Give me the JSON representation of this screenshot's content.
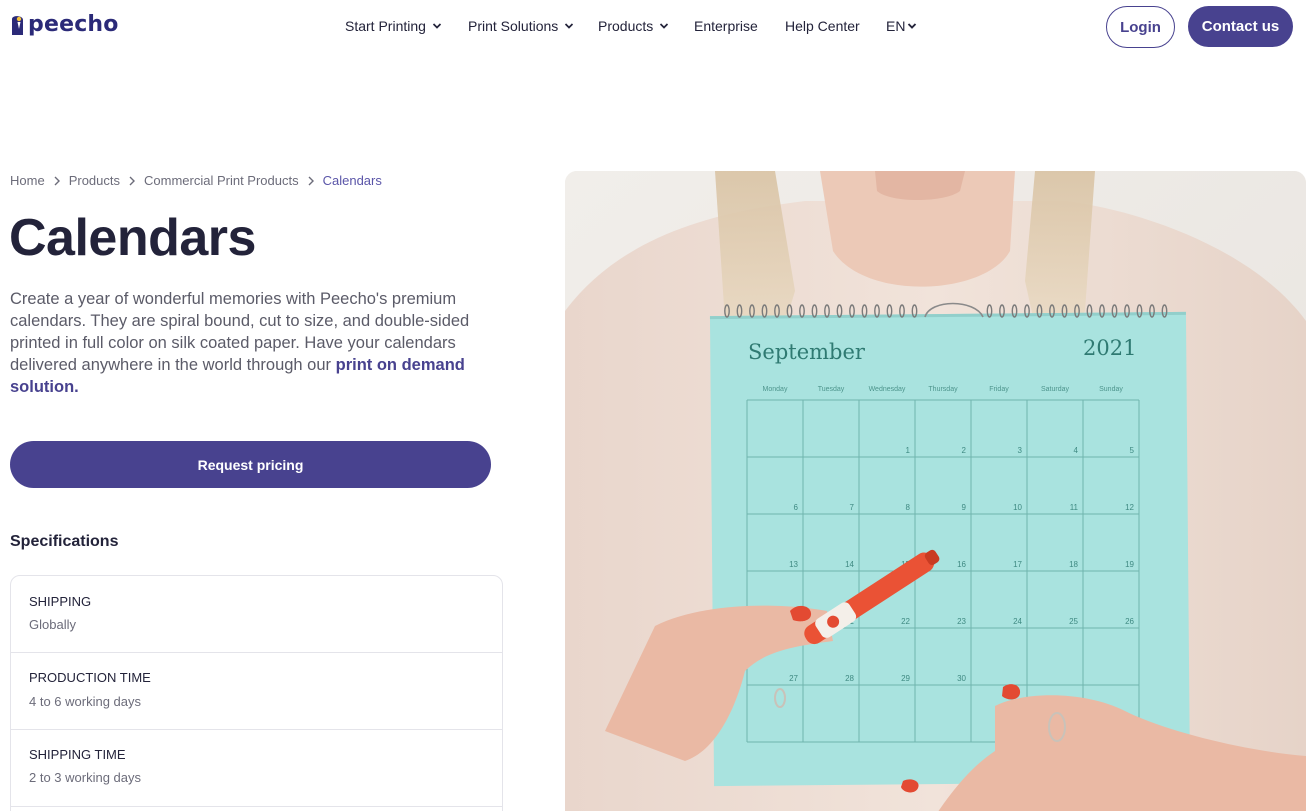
{
  "brand": {
    "name": "peecho",
    "color": "#2b2a78",
    "accent": "#48428f"
  },
  "nav": {
    "items": [
      {
        "label": "Start Printing",
        "dropdown": true
      },
      {
        "label": "Print Solutions",
        "dropdown": true
      },
      {
        "label": "Products",
        "dropdown": true
      },
      {
        "label": "Enterprise",
        "dropdown": false
      },
      {
        "label": "Help Center",
        "dropdown": false
      },
      {
        "label": "EN",
        "dropdown": true
      }
    ],
    "login_label": "Login",
    "contact_label": "Contact us"
  },
  "breadcrumb": [
    "Home",
    "Products",
    "Commercial Print Products",
    "Calendars"
  ],
  "page": {
    "title": "Calendars",
    "description_text": "Create a year of wonderful memories with Peecho's premium calendars. They are spiral bound, cut to size, and double-sided printed in full color on silk coated paper. Have your calendars delivered anywhere in the world through our ",
    "description_link": "print on demand solution.",
    "request_label": "Request pricing",
    "specs_title": "Specifications"
  },
  "specs": [
    {
      "label": "SHIPPING",
      "value": "Globally"
    },
    {
      "label": "PRODUCTION TIME",
      "value": "4 to 6 working days"
    },
    {
      "label": "SHIPPING TIME",
      "value": "2 to 3 working days"
    }
  ],
  "hero": {
    "month": "September",
    "year": "2021",
    "weekdays": [
      "Monday",
      "Tuesday",
      "Wednesday",
      "Thursday",
      "Friday",
      "Saturday",
      "Sunday"
    ],
    "days": [
      "1",
      "2",
      "3",
      "4",
      "5",
      "6",
      "7",
      "8",
      "9",
      "10",
      "11",
      "12",
      "13",
      "14",
      "15",
      "16",
      "17",
      "18",
      "19",
      "20",
      "21",
      "22",
      "23",
      "24",
      "25",
      "26",
      "27",
      "28",
      "29",
      "30"
    ],
    "calendar_color": "#a9e3df"
  }
}
